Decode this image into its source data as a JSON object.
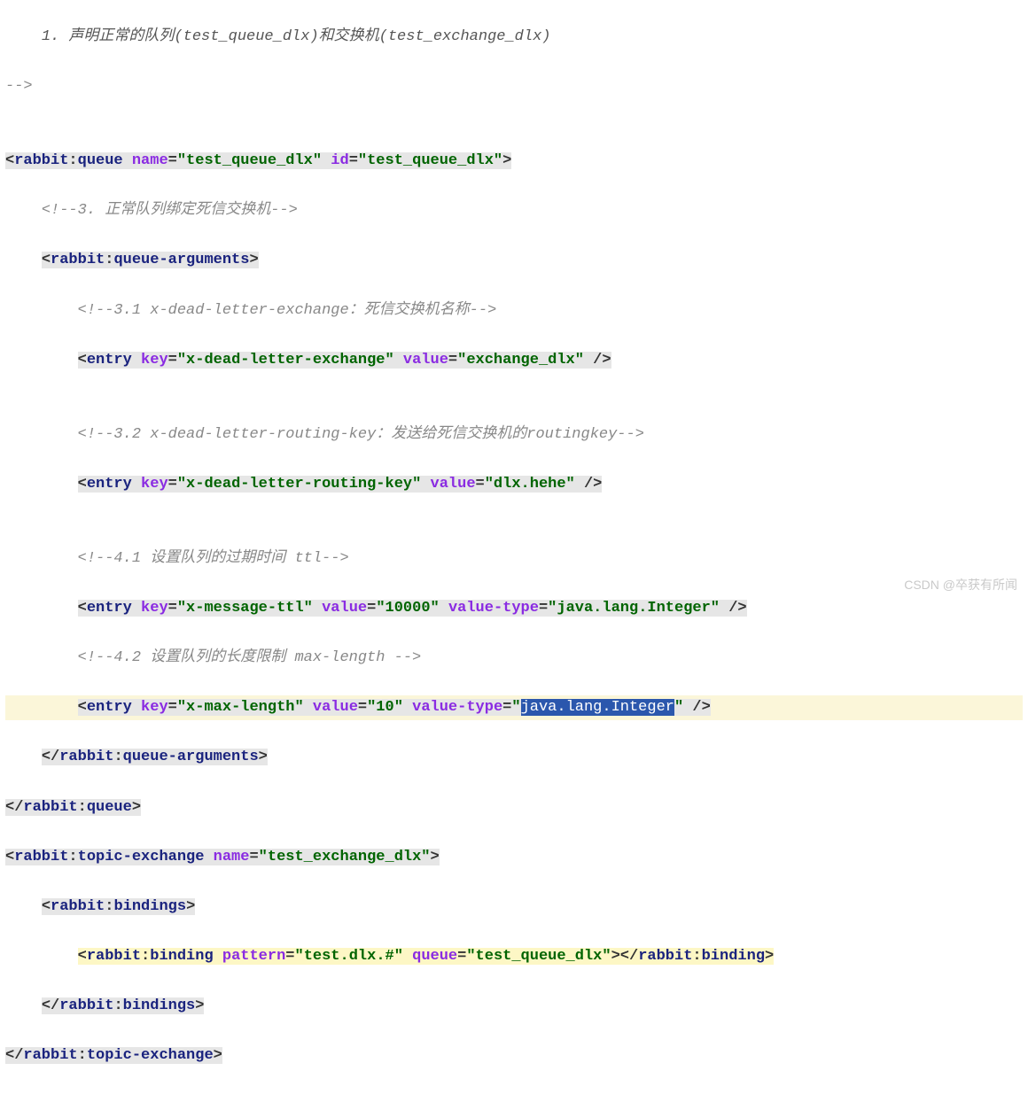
{
  "lines": {
    "ol": "1. 声明正常的队列(test_queue_dlx)和交换机(test_exchange_dlx)",
    "close_comment": "-->",
    "blank": "",
    "queue_open": {
      "pre": "<",
      "ns": "rabbit",
      "name": "queue",
      "attrs": [
        {
          "k": "name",
          "v": "\"test_queue_dlx\""
        },
        {
          "k": "id",
          "v": "\"test_queue_dlx\""
        }
      ],
      "post": ">"
    },
    "c3": "<!--3. 正常队列绑定死信交换机-->",
    "qa_open": {
      "pre": "<",
      "ns": "rabbit",
      "name": "queue-arguments",
      "post": ">"
    },
    "c31": "<!--3.1 x-dead-letter-exchange：死信交换机名称-->",
    "entry1": {
      "pre": "<",
      "name": "entry",
      "attrs": [
        {
          "k": "key",
          "v": "\"x-dead-letter-exchange\""
        },
        {
          "k": "value",
          "v": "\"exchange_dlx\""
        }
      ],
      "post": " />"
    },
    "c32": "<!--3.2 x-dead-letter-routing-key：发送给死信交换机的routingkey-->",
    "entry2": {
      "pre": "<",
      "name": "entry",
      "attrs": [
        {
          "k": "key",
          "v": "\"x-dead-letter-routing-key\""
        },
        {
          "k": "value",
          "v": "\"dlx.hehe\""
        }
      ],
      "post": " />"
    },
    "c41": "<!--4.1 设置队列的过期时间 ttl-->",
    "entry3": {
      "pre": "<",
      "name": "entry",
      "attrs": [
        {
          "k": "key",
          "v": "\"x-message-ttl\""
        },
        {
          "k": "value",
          "v": "\"10000\""
        },
        {
          "k": "value-type",
          "v": "\"java.lang.Integer\""
        }
      ],
      "post": " />"
    },
    "c42": "<!--4.2 设置队列的长度限制 max-length -->",
    "entry4": {
      "pre": "<",
      "name": "entry",
      "attrs": [
        {
          "k": "key",
          "v": "\"x-max-length\""
        },
        {
          "k": "value",
          "v": "\"10\""
        },
        {
          "k": "value-type",
          "v": "\"",
          "sel": "java.lang.Integer",
          "vend": "\""
        }
      ],
      "post": " />"
    },
    "qa_close": {
      "pre": "</",
      "ns": "rabbit",
      "name": "queue-arguments",
      "post": ">"
    },
    "queue_close": {
      "pre": "</",
      "ns": "rabbit",
      "name": "queue",
      "post": ">"
    },
    "te_open": {
      "pre": "<",
      "ns": "rabbit",
      "name": "topic-exchange",
      "attrs": [
        {
          "k": "name",
          "v": "\"test_exchange_dlx\""
        }
      ],
      "post": ">"
    },
    "rb_open": {
      "pre": "<",
      "ns": "rabbit",
      "name": "bindings",
      "post": ">"
    },
    "binding": {
      "pre": "<",
      "ns": "rabbit",
      "name": "binding",
      "attrs": [
        {
          "k": "pattern",
          "v": "\"test.dlx.#\""
        },
        {
          "k": "queue",
          "v": "\"test_queue_dlx\""
        }
      ],
      "post": ">",
      "close_pre": "</",
      "close_ns": "rabbit",
      "close_name": "binding",
      "close_post": ">"
    },
    "rb_close": {
      "pre": "</",
      "ns": "rabbit",
      "name": "bindings",
      "post": ">"
    },
    "te_close": {
      "pre": "</",
      "ns": "rabbit",
      "name": "topic-exchange",
      "post": ">"
    }
  },
  "watermark": "CSDN @卒获有所闻"
}
